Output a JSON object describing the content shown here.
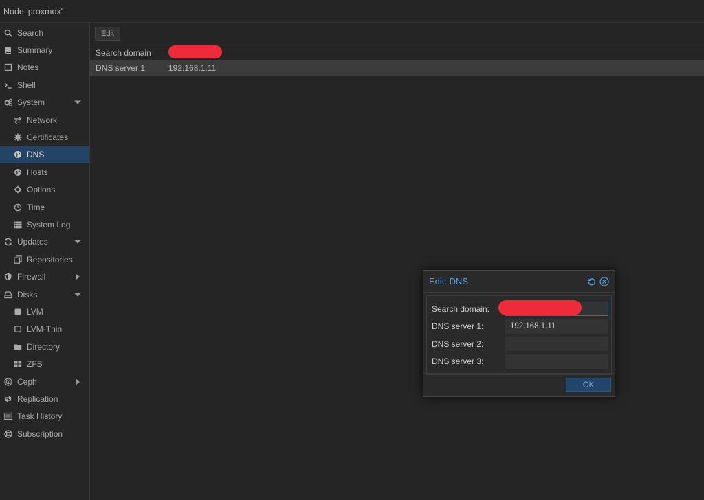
{
  "window": {
    "title": "Node 'proxmox'"
  },
  "sidebar": {
    "items": [
      {
        "label": "Search",
        "icon": "search-icon"
      },
      {
        "label": "Summary",
        "icon": "book-icon"
      },
      {
        "label": "Notes",
        "icon": "note-icon"
      },
      {
        "label": "Shell",
        "icon": "terminal-icon"
      },
      {
        "label": "System",
        "icon": "cogs-icon",
        "expanded": true
      },
      {
        "label": "Network",
        "icon": "exchange-icon"
      },
      {
        "label": "Certificates",
        "icon": "certificate-icon"
      },
      {
        "label": "DNS",
        "icon": "globe-icon",
        "selected": true
      },
      {
        "label": "Hosts",
        "icon": "globe-icon"
      },
      {
        "label": "Options",
        "icon": "gear-icon"
      },
      {
        "label": "Time",
        "icon": "clock-icon"
      },
      {
        "label": "System Log",
        "icon": "list-icon"
      },
      {
        "label": "Updates",
        "icon": "refresh-icon",
        "expanded": true
      },
      {
        "label": "Repositories",
        "icon": "files-icon"
      },
      {
        "label": "Firewall",
        "icon": "shield-icon",
        "expanded": false
      },
      {
        "label": "Disks",
        "icon": "hdd-icon",
        "expanded": true
      },
      {
        "label": "LVM",
        "icon": "square-icon"
      },
      {
        "label": "LVM-Thin",
        "icon": "square-outline-icon"
      },
      {
        "label": "Directory",
        "icon": "folder-icon"
      },
      {
        "label": "ZFS",
        "icon": "grid-icon"
      },
      {
        "label": "Ceph",
        "icon": "ceph-icon",
        "expanded": false
      },
      {
        "label": "Replication",
        "icon": "retweet-icon"
      },
      {
        "label": "Task History",
        "icon": "list-alt-icon"
      },
      {
        "label": "Subscription",
        "icon": "support-icon"
      }
    ]
  },
  "toolbar": {
    "edit_label": "Edit"
  },
  "dns_grid": {
    "rows": [
      {
        "key": "Search domain",
        "value": ""
      },
      {
        "key": "DNS server 1",
        "value": "192.168.1.11"
      }
    ]
  },
  "dialog": {
    "title": "Edit: DNS",
    "fields": [
      {
        "label": "Search domain:",
        "value": ""
      },
      {
        "label": "DNS server 1:",
        "value": "192.168.1.11"
      },
      {
        "label": "DNS server 2:",
        "value": ""
      },
      {
        "label": "DNS server 3:",
        "value": ""
      }
    ],
    "ok_label": "OK"
  },
  "colors": {
    "selected_bg": "#234465",
    "accent": "#5aa0e0",
    "redaction": "#ef2a3a"
  }
}
